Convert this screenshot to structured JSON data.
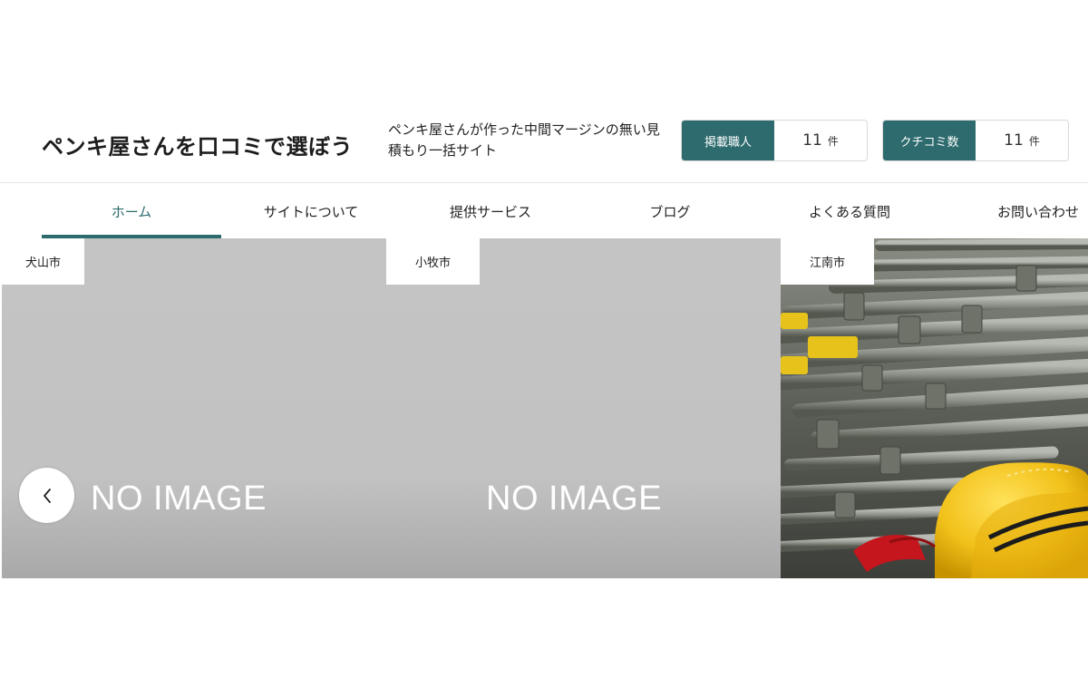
{
  "header": {
    "site_title": "ペンキ屋さんを口コミで選ぼう",
    "tagline": "ペンキ屋さんが作った中間マージンの無い見積もり一括サイト",
    "stats": [
      {
        "label": "掲載職人",
        "value": "11",
        "unit": "件"
      },
      {
        "label": "クチコミ数",
        "value": "11",
        "unit": "件"
      }
    ]
  },
  "nav": {
    "items": [
      {
        "label": "ホーム"
      },
      {
        "label": "サイトについて"
      },
      {
        "label": "提供サービス"
      },
      {
        "label": "ブログ"
      },
      {
        "label": "よくある質問"
      },
      {
        "label": "お問い合わせ"
      }
    ],
    "active_index": 0
  },
  "slider": {
    "slides": [
      {
        "city": "犬山市",
        "image_text": "NO IMAGE"
      },
      {
        "city": "小牧市",
        "image_text": "NO IMAGE"
      },
      {
        "city": "江南市",
        "image": "scaffolding-pipes-and-yellow-hardhat-photo"
      }
    ],
    "prev_icon": "chevron-left-icon"
  },
  "colors": {
    "accent": "#2e6b6e",
    "placeholder_gray": "#c4c4c4"
  }
}
